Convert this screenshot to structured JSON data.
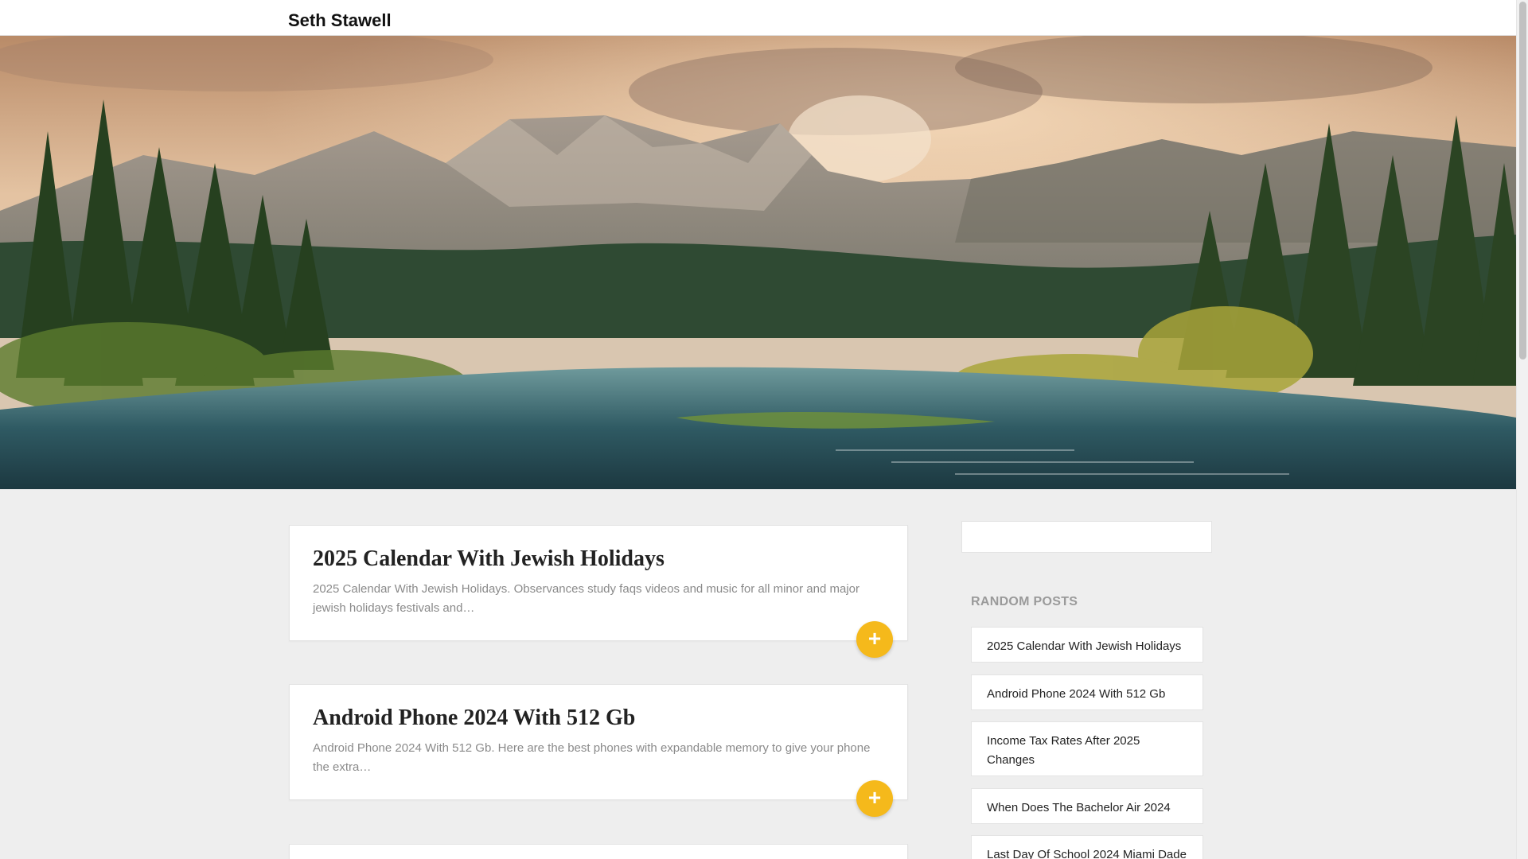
{
  "header": {
    "site_title": "Seth Stawell"
  },
  "posts": [
    {
      "title": "2025 Calendar With Jewish Holidays",
      "excerpt": "2025 Calendar With Jewish Holidays. Observances study faqs videos and music for all minor and major jewish holidays festivals and…",
      "more_label": "+"
    },
    {
      "title": "Android Phone 2024 With 512 Gb",
      "excerpt": "Android Phone 2024 With 512 Gb. Here are the best phones with expandable memory to give your phone the extra…",
      "more_label": "+"
    }
  ],
  "sidebar": {
    "random_posts_title": "RANDOM POSTS",
    "random_posts": [
      "2025 Calendar With Jewish Holidays",
      "Android Phone 2024 With 512 Gb",
      "Income Tax Rates After 2025 Changes",
      "When Does The Bachelor Air 2024",
      "Last Day Of School 2024 Miami Dade"
    ]
  },
  "colors": {
    "accent": "#f5b91b",
    "background": "#eeeeee",
    "card": "#ffffff"
  },
  "icons": {
    "more": "plus-icon"
  }
}
